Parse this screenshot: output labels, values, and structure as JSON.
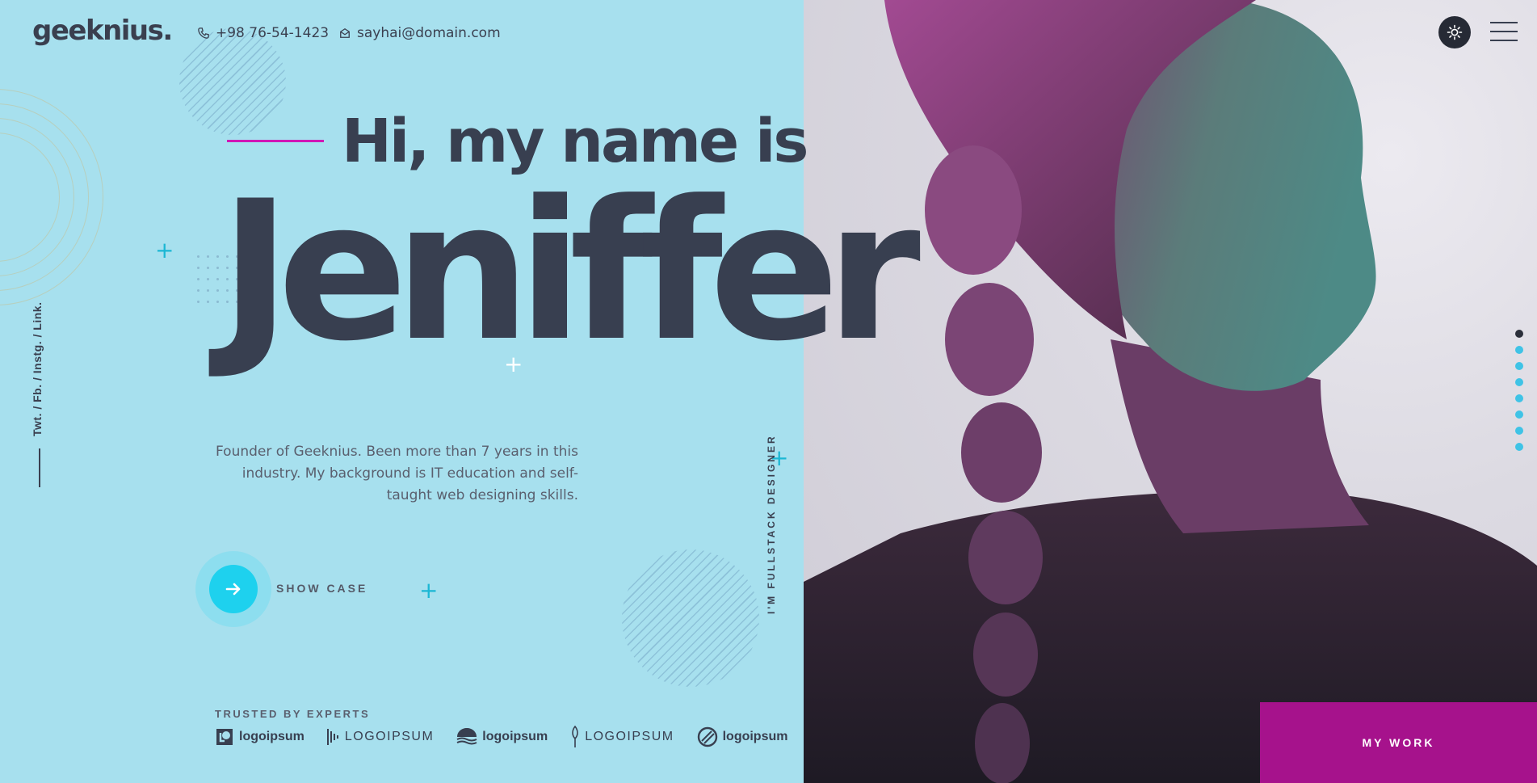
{
  "header": {
    "logo": "geeknius.",
    "phone": "+98 76-54-1423",
    "email": "sayhai@domain.com",
    "theme_icon": "sun-icon",
    "menu_icon": "hamburger-icon"
  },
  "social": {
    "links": "Twt. / Fb. / Instg. / Link."
  },
  "hero": {
    "greeting": "Hi, my name is",
    "name": "Jeniffer",
    "description": "Founder of Geeknius. Been more than 7 years in this industry. My background is IT education and self-taught web designing skills.",
    "vertical_tag": "I'M FULLSTACK DESIGNER",
    "showcase_label": "SHOW CASE",
    "showcase_icon": "arrow-right-icon"
  },
  "trusted": {
    "label": "TRUSTED BY EXPERTS",
    "logos": [
      "logoipsum",
      "LOGOIPSUM",
      "logoipsum",
      "LOGOIPSUM",
      "logoipsum"
    ]
  },
  "pager": {
    "count": 8,
    "active": 0
  },
  "cta": {
    "my_work": "MY WORK"
  },
  "colors": {
    "background": "#a7e0ee",
    "text_dark": "#383f50",
    "accent_magenta": "#d018b6",
    "accent_cyan": "#1ed1ee",
    "cta_purple": "#a6128c"
  }
}
